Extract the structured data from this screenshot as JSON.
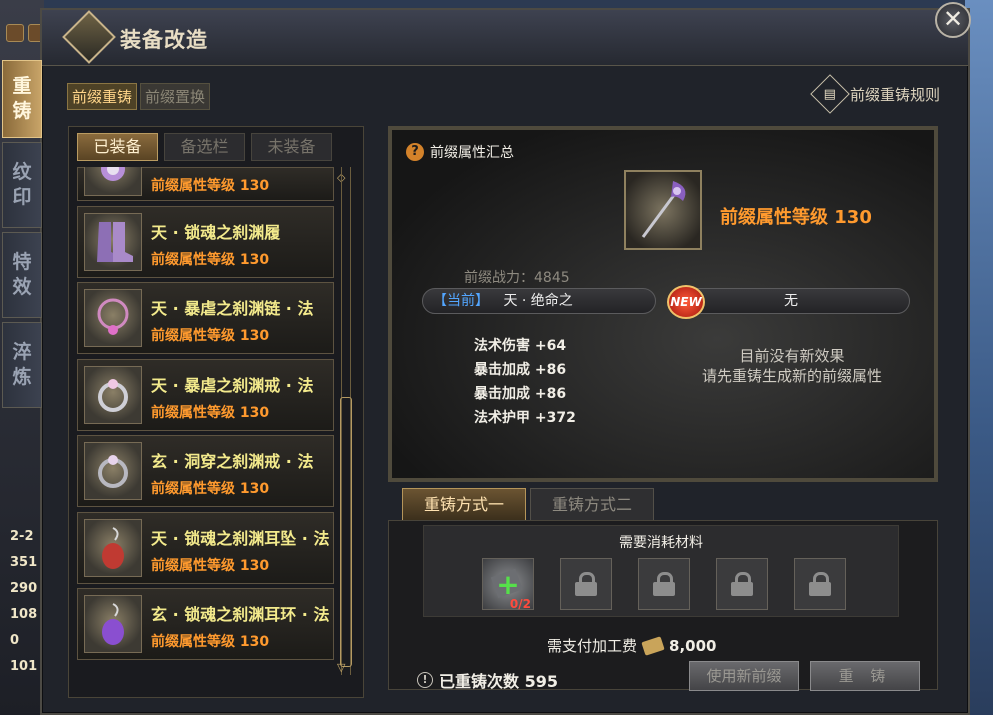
{
  "window": {
    "title": "装备改造",
    "close_label": "✕"
  },
  "side_tabs": [
    {
      "label": "重\n铸",
      "active": true
    },
    {
      "label": "纹\n印",
      "active": false
    },
    {
      "label": "特\n效",
      "active": false
    },
    {
      "label": "淬\n炼",
      "active": false
    }
  ],
  "mode_tabs": [
    {
      "label": "前缀重铸",
      "active": true
    },
    {
      "label": "前缀置换",
      "active": false
    }
  ],
  "rules_link": "前缀重铸规则",
  "filter_tabs": [
    {
      "label": "已装备",
      "active": true
    },
    {
      "label": "备选栏",
      "active": false
    },
    {
      "label": "未装备",
      "active": false
    }
  ],
  "items": [
    {
      "name": "",
      "level": "前缀属性等级 130"
    },
    {
      "name": "天 · 锁魂之刹渊履",
      "level": "前缀属性等级 130"
    },
    {
      "name": "天 · 暴虐之刹渊链 · 法",
      "level": "前缀属性等级 130"
    },
    {
      "name": "天 · 暴虐之刹渊戒 · 法",
      "level": "前缀属性等级 130"
    },
    {
      "name": "玄 · 洞穿之刹渊戒 · 法",
      "level": "前缀属性等级 130"
    },
    {
      "name": "天 · 锁魂之刹渊耳坠 · 法",
      "level": "前缀属性等级 130"
    },
    {
      "name": "玄 · 锁魂之刹渊耳环 · 法",
      "level": "前缀属性等级 130"
    }
  ],
  "detail": {
    "summary_title": "前缀属性汇总",
    "item_level": "前缀属性等级 130",
    "power": "前缀战力：4845",
    "current_tag": "【当前】",
    "current_value": "天 · 绝命之",
    "new_badge": "NEW",
    "new_value": "无",
    "stats": [
      "法术伤害 +64",
      "暴击加成 +86",
      "暴击加成 +86",
      "法术护甲 +372"
    ],
    "no_effect_line1": "目前没有新效果",
    "no_effect_line2": "请先重铸生成新的前缀属性"
  },
  "method_tabs": [
    {
      "label": "重铸方式一",
      "active": true
    },
    {
      "label": "重铸方式二",
      "active": false
    }
  ],
  "materials": {
    "title": "需要消耗材料",
    "first_slot_count": "0/2"
  },
  "fee": {
    "label": "需支付加工费",
    "amount": "8,000"
  },
  "reforge_count": "已重铸次数 595",
  "buttons": {
    "use_new": "使用新前缀",
    "reforge": "重 铸"
  },
  "left_stats": [
    "2-2",
    "351",
    "290",
    "108",
    "0",
    "101"
  ]
}
